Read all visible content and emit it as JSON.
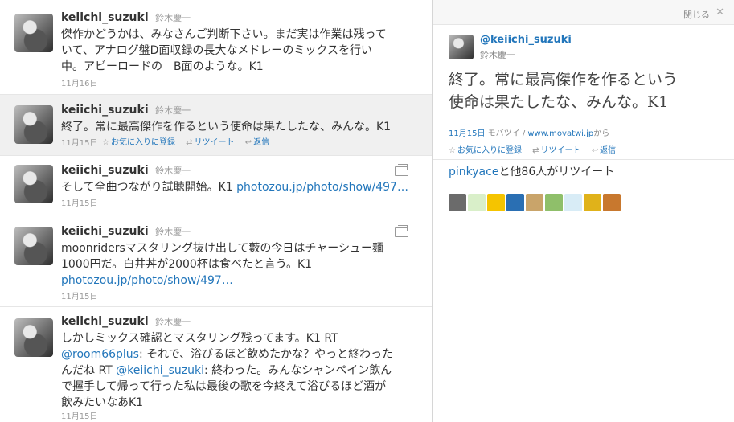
{
  "timeline": [
    {
      "username": "keiichi_suzuki",
      "fullname": "鈴木慶一",
      "lines": [
        "傑作かどうかは、みなさんご判断下さい。まだ実は作業は残って",
        "いて、アナログ盤D面収録の長大なメドレーのミックスを行い",
        "中。アビーロードの　B面のような。K1"
      ],
      "date": "11月16日"
    },
    {
      "username": "keiichi_suzuki",
      "fullname": "鈴木慶一",
      "lines": [
        "終了。常に最高傑作を作るという使命は果たしたな、みんな。K1"
      ],
      "date": "11月15日",
      "favorite": "お気に入りに登録",
      "retweet": "リツイート",
      "reply": "返信"
    },
    {
      "username": "keiichi_suzuki",
      "fullname": "鈴木慶一",
      "text_prefix": "そして全曲つながり試聴開始。K1 ",
      "link": "photozou.jp/photo/show/497…",
      "date": "11月15日"
    },
    {
      "username": "keiichi_suzuki",
      "fullname": "鈴木慶一",
      "lines": [
        "moonridersマスタリング抜け出して藪の今日はチャーシュー麺",
        "1000円だ。白井丼が2000杯は食べたと言う。K1"
      ],
      "link": "photozou.jp/photo/show/497…",
      "date": "11月15日"
    },
    {
      "username": "keiichi_suzuki",
      "fullname": "鈴木慶一",
      "line1": "しかしミックス確認とマスタリング残ってます。K1 RT",
      "mention1": "@room66plus",
      "line2_rest": ": それで、浴びるほど飲めたかな？やっと終わった",
      "line3_pre": "んだね RT ",
      "mention2": "@keiichi_suzuki",
      "line3_rest": ": 終わった。みんなシャンペイン飲ん",
      "line4": "で握手して帰って行った私は最後の歌を今終えて浴びるほど酒が",
      "line5": "飲みたいなあK1",
      "date": "11月15日"
    }
  ],
  "detail": {
    "close_label": "閉じる",
    "close_icon": "close-icon",
    "username": "@keiichi_suzuki",
    "fullname": "鈴木慶一",
    "text_lines": [
      "終了。常に最高傑作を作るという",
      "使命は果たしたな、みんな。K1"
    ],
    "date": "11月15日",
    "via_pre": "モバツイ / ",
    "via_link": "www.movatwi.jp",
    "via_post": "から",
    "favorite": "お気に入りに登録",
    "retweet": "リツイート",
    "reply": "返信",
    "rt_user": "pinkyace",
    "rt_rest": "と他86人がリツイート",
    "rt_avatar_colors": [
      "#6b6b6b",
      "#d9efc9",
      "#f5c400",
      "#2a6fb3",
      "#c9a46a",
      "#8fbf6a",
      "#d8ecf6",
      "#e0b21a",
      "#c8782e"
    ]
  }
}
